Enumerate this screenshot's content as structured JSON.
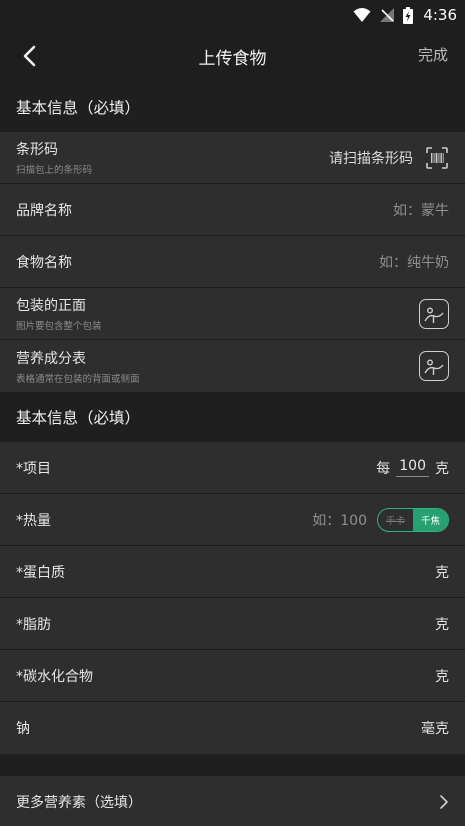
{
  "status": {
    "time": "4:36"
  },
  "nav": {
    "title": "上传食物",
    "done": "完成"
  },
  "section1": {
    "title": "基本信息（必填）",
    "barcode": {
      "label": "条形码",
      "sub": "扫描包上的条形码",
      "action": "请扫描条形码"
    },
    "brand": {
      "label": "品牌名称",
      "placeholder": "如：蒙牛"
    },
    "food": {
      "label": "食物名称",
      "placeholder": "如：纯牛奶"
    },
    "front": {
      "label": "包装的正面",
      "sub": "图片要包含整个包装"
    },
    "nutrition": {
      "label": "营养成分表",
      "sub": "表格通常在包装的背面或侧面"
    }
  },
  "section2": {
    "title": "基本信息（必填）",
    "item": {
      "label": "*项目",
      "per": "每",
      "amount": "100",
      "unit": "克"
    },
    "energy": {
      "label": "*热量",
      "placeholder": "如：100",
      "toggle_off": "千卡",
      "toggle_on": "千焦"
    },
    "protein": {
      "label": "*蛋白质",
      "unit": "克"
    },
    "fat": {
      "label": "*脂肪",
      "unit": "克"
    },
    "carb": {
      "label": "*碳水化合物",
      "unit": "克"
    },
    "sodium": {
      "label": "钠",
      "unit": "毫克"
    }
  },
  "more": {
    "label": "更多营养素（选填）"
  },
  "colors": {
    "accent": "#26a172",
    "background": "#1e1e1e",
    "row": "#2e2e2e"
  }
}
